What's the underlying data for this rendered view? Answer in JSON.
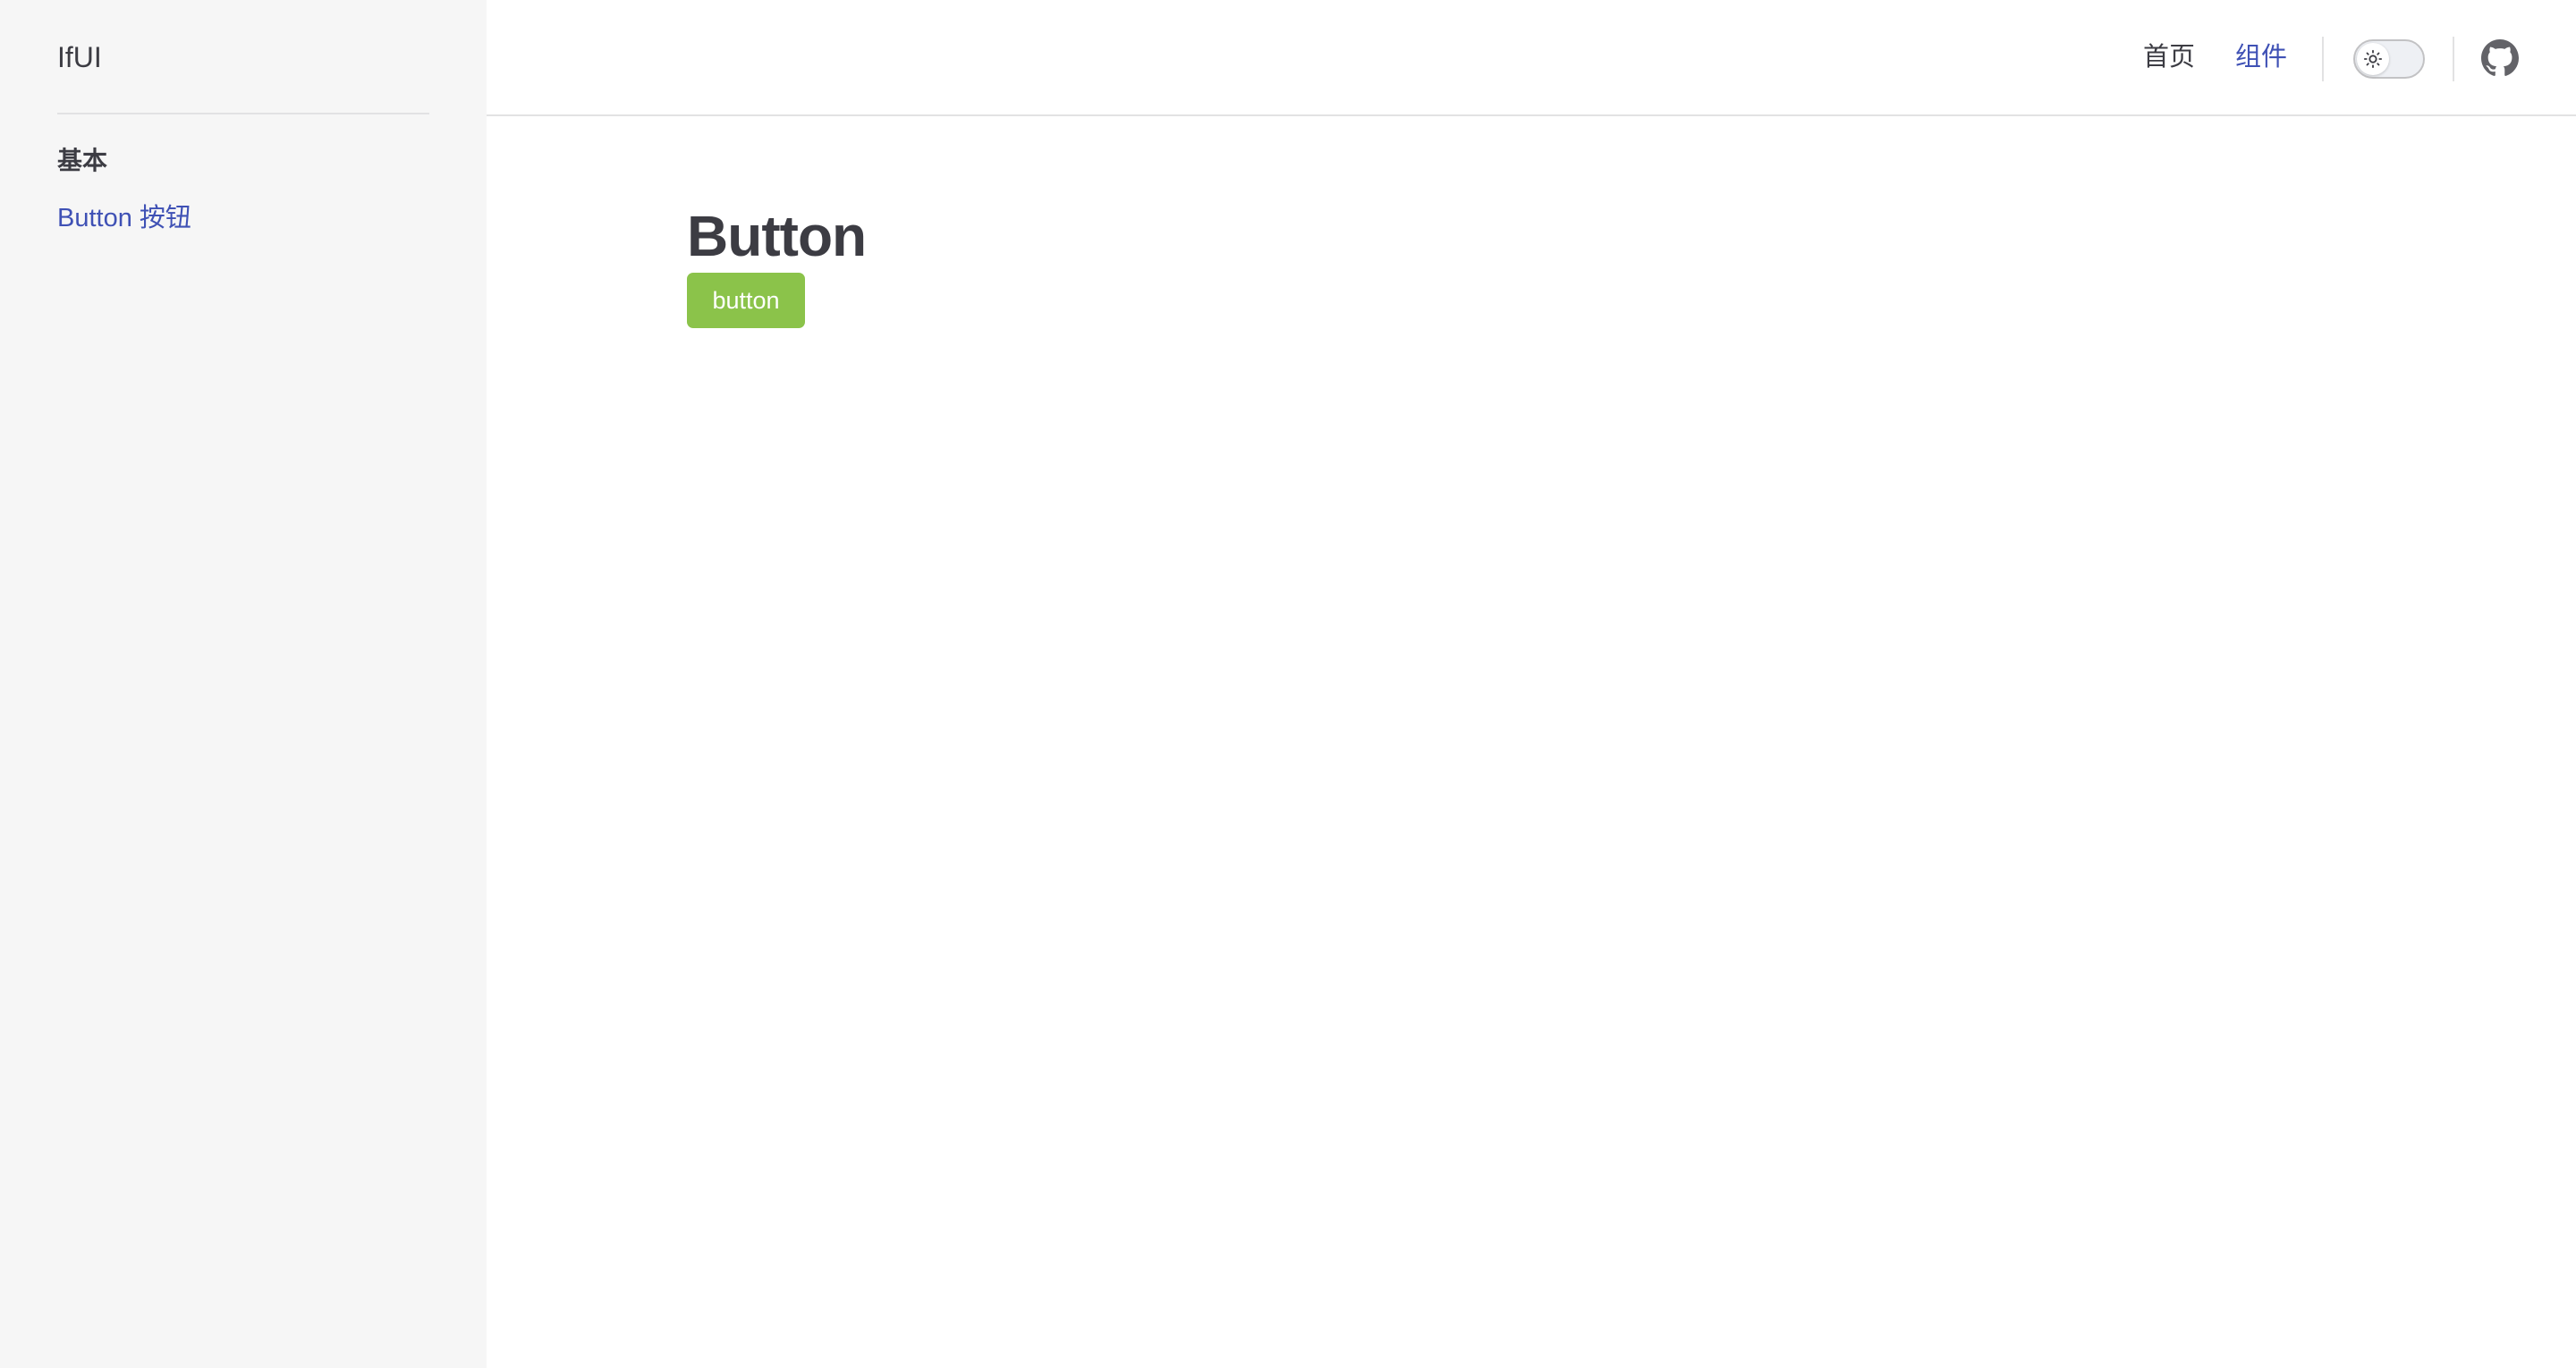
{
  "sidebar": {
    "logo": "IfUI",
    "groups": [
      {
        "title": "基本",
        "items": [
          {
            "label": "Button 按钮"
          }
        ]
      }
    ]
  },
  "header": {
    "nav": [
      {
        "label": "首页",
        "active": false
      },
      {
        "label": "组件",
        "active": true
      }
    ],
    "theme_toggle": {
      "icon": "sun-icon",
      "dark": false
    },
    "github_icon": "github-icon"
  },
  "main": {
    "title": "Button",
    "demo_button_label": "button"
  },
  "colors": {
    "text": "#3c3c43",
    "accent": "#3f51b5",
    "button_green": "#8bc34a",
    "sidebar_bg": "#f6f6f6"
  }
}
